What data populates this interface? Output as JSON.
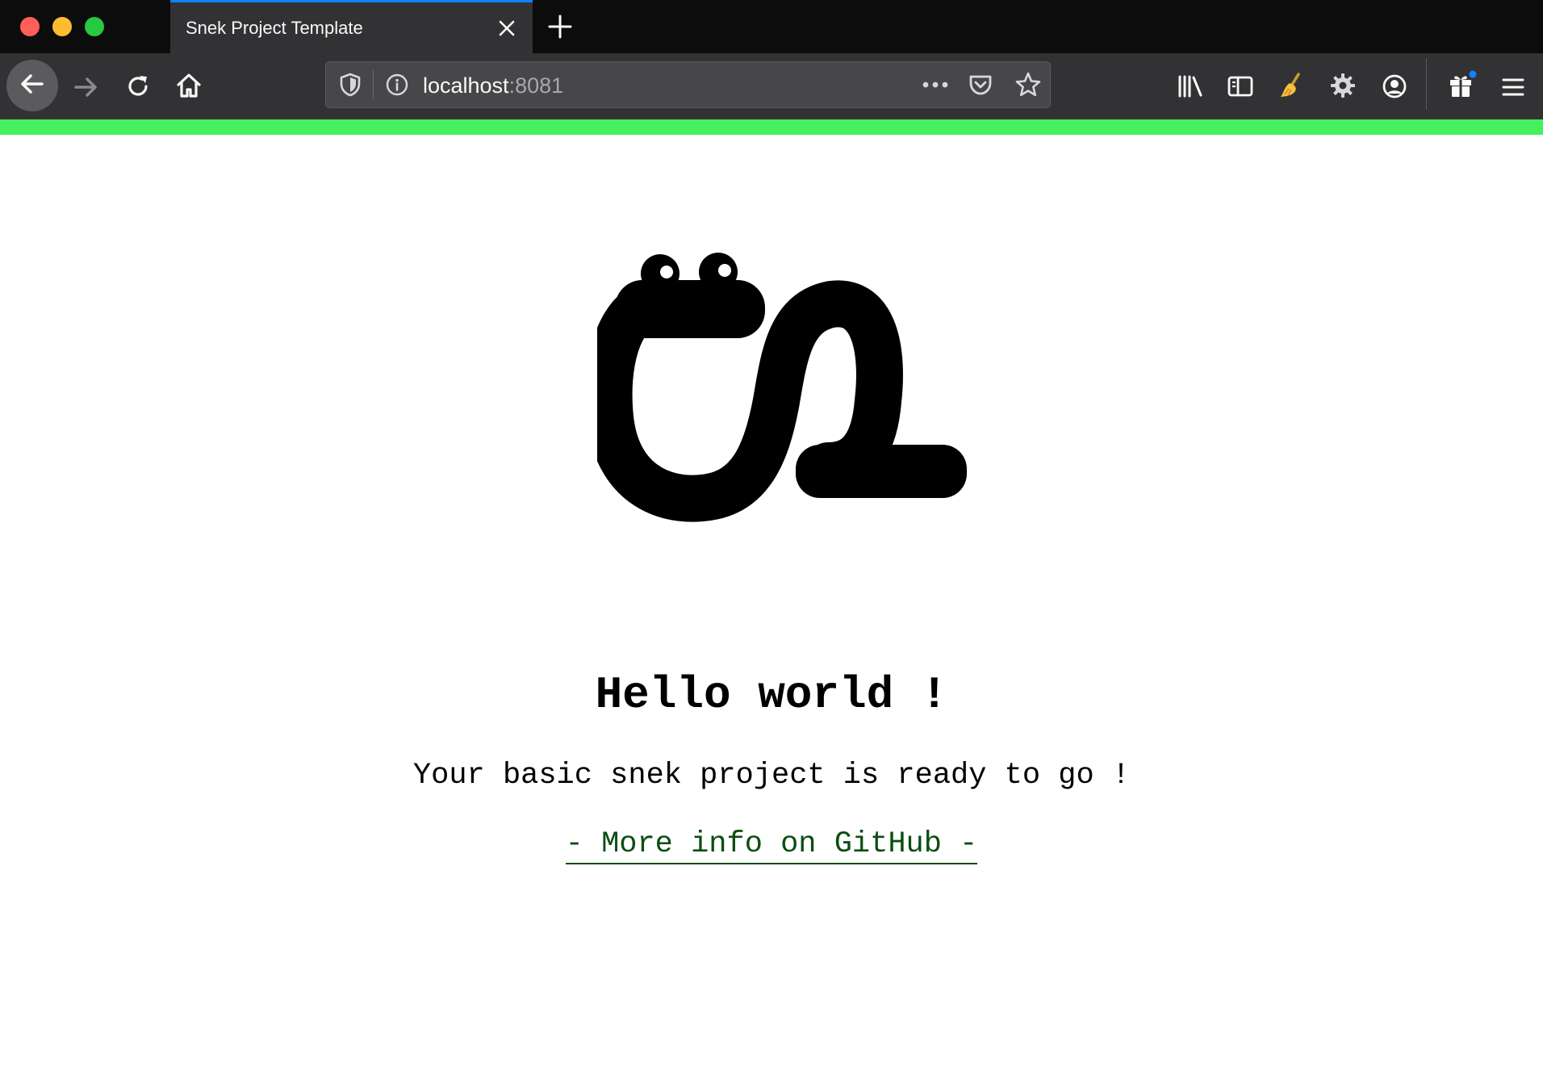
{
  "window": {
    "tab": {
      "title": "Snek Project Template"
    },
    "url": {
      "host": "localhost",
      "port": ":8081"
    },
    "colors": {
      "tab_accent": "#0a84ff",
      "page_top_bar": "#45ef5f",
      "link": "#0b4d12"
    },
    "icons": {
      "nav": [
        "back-arrow-icon",
        "forward-arrow-icon",
        "reload-icon",
        "home-icon"
      ],
      "urlbar": [
        "shield-icon",
        "info-icon",
        "more-actions-icon",
        "pocket-icon",
        "bookmark-star-icon"
      ],
      "toolbar": [
        "library-icon",
        "sidebar-icon",
        "broom-extension-icon",
        "gear-extension-icon",
        "account-icon",
        "gift-icon",
        "hamburger-menu-icon"
      ]
    }
  },
  "page": {
    "heading": "Hello world !",
    "subtext": "Your basic snek project is ready to go !",
    "link_label": "- More info on GitHub -"
  }
}
